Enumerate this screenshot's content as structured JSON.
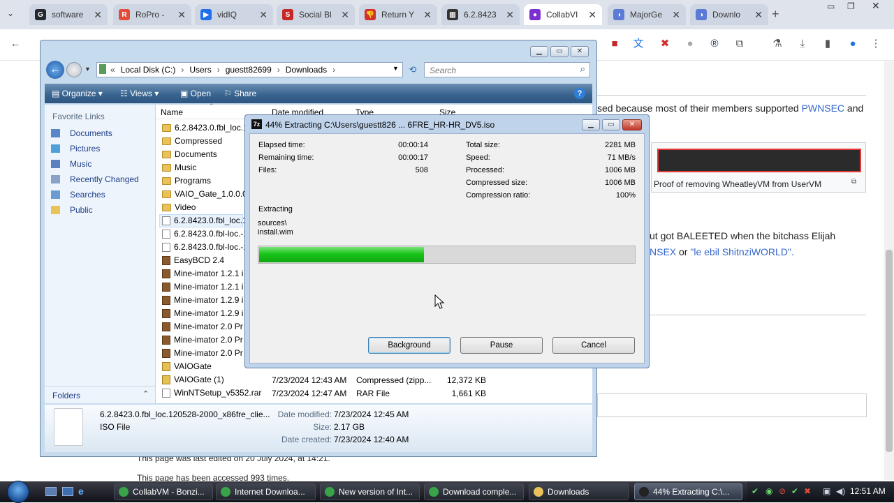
{
  "browser": {
    "tabs": [
      {
        "label": "software",
        "color": "#24292e",
        "glyph": "G"
      },
      {
        "label": "RoPro - ",
        "color": "#e34b3b",
        "glyph": "R"
      },
      {
        "label": "vidIQ",
        "color": "#1f6feb",
        "glyph": "▶"
      },
      {
        "label": "Social Bl",
        "color": "#c62828",
        "glyph": "S"
      },
      {
        "label": "Return Y",
        "color": "#d32f2f",
        "glyph": "👎"
      },
      {
        "label": "6.2.8423",
        "color": "#333333",
        "glyph": "▥"
      },
      {
        "label": "CollabVI",
        "color": "#7b2fd1",
        "glyph": "●",
        "active": true
      },
      {
        "label": "MajorGe",
        "color": "#5c7bd6",
        "glyph": "◑"
      },
      {
        "label": "Downlo",
        "color": "#5c7bd6",
        "glyph": "◑"
      }
    ]
  },
  "webpage": {
    "line1_a": "sed because most of their members supported ",
    "line1_link": "PWNSEC",
    "line1_b": " and",
    "caption": "Proof of removing WheatleyVM from UserVM",
    "line2": "ut got BALEETED when the bitchass Elijah",
    "line3_a": "NSEX",
    "line3_b": " or ",
    "line3_c": "\"le ebil ShitnziWORLD\".",
    "footer1": "This page was last edited on 20 July 2024, at 14:21.",
    "footer2": "This page has been accessed 993 times."
  },
  "explorer": {
    "breadcrumb": [
      "«",
      "Local Disk (C:)",
      "›",
      "Users",
      "›",
      "guestt82699",
      "›",
      "Downloads",
      "›"
    ],
    "search_placeholder": "Search",
    "commands": {
      "organize": "Organize",
      "views": "Views",
      "open": "Open",
      "share": "Share"
    },
    "favorite_links_title": "Favorite Links",
    "nav": [
      "Documents",
      "Pictures",
      "Music",
      "Recently Changed",
      "Searches",
      "Public"
    ],
    "folders_label": "Folders",
    "columns": {
      "name": "Name",
      "date": "Date modified",
      "type": "Type",
      "size": "Size"
    },
    "files": [
      {
        "name": "6.2.8423.0.fbl_loc.12",
        "icon": "folder",
        "date": "",
        "type": "",
        "size": ""
      },
      {
        "name": "Compressed",
        "icon": "folder",
        "date": "",
        "type": "",
        "size": ""
      },
      {
        "name": "Documents",
        "icon": "folder",
        "date": "",
        "type": "",
        "size": ""
      },
      {
        "name": "Music",
        "icon": "folder",
        "date": "",
        "type": "",
        "size": ""
      },
      {
        "name": "Programs",
        "icon": "folder",
        "date": "",
        "type": "",
        "size": ""
      },
      {
        "name": "VAIO_Gate_1.0.0.08",
        "icon": "folder",
        "date": "",
        "type": "",
        "size": ""
      },
      {
        "name": "Video",
        "icon": "folder",
        "date": "",
        "type": "",
        "size": ""
      },
      {
        "name": "6.2.8423.0.fbl_loc.12",
        "icon": "doc",
        "date": "",
        "type": "",
        "size": ""
      },
      {
        "name": "6.2.8423.0.fbl-loc.-1",
        "icon": "doc",
        "date": "",
        "type": "",
        "size": ""
      },
      {
        "name": "6.2.8423.0.fbl-loc.-1",
        "icon": "doc",
        "date": "",
        "type": "",
        "size": ""
      },
      {
        "name": "EasyBCD 2.4",
        "icon": "pkg",
        "date": "",
        "type": "",
        "size": ""
      },
      {
        "name": "Mine-imator 1.2.1 i",
        "icon": "pkg",
        "date": "",
        "type": "",
        "size": ""
      },
      {
        "name": "Mine-imator 1.2.1 i",
        "icon": "pkg",
        "date": "",
        "type": "",
        "size": ""
      },
      {
        "name": "Mine-imator 1.2.9 i",
        "icon": "pkg",
        "date": "",
        "type": "",
        "size": ""
      },
      {
        "name": "Mine-imator 1.2.9 i",
        "icon": "pkg",
        "date": "",
        "type": "",
        "size": ""
      },
      {
        "name": "Mine-imator 2.0 Pr",
        "icon": "pkg",
        "date": "",
        "type": "",
        "size": ""
      },
      {
        "name": "Mine-imator 2.0 Pr",
        "icon": "pkg",
        "date": "",
        "type": "",
        "size": ""
      },
      {
        "name": "Mine-imator 2.0 Pr",
        "icon": "pkg",
        "date": "",
        "type": "",
        "size": ""
      },
      {
        "name": "VAIOGate",
        "icon": "zip",
        "date": "",
        "type": "",
        "size": ""
      },
      {
        "name": "VAIOGate (1)",
        "icon": "zip",
        "date": "7/23/2024 12:43 AM",
        "type": "Compressed (zipp...",
        "size": "12,372 KB"
      },
      {
        "name": "WinNTSetup_v5352.rar",
        "icon": "rar",
        "date": "7/23/2024 12:47 AM",
        "type": "RAR File",
        "size": "1,661 KB"
      }
    ],
    "details": {
      "filename": "6.2.8423.0.fbl_loc.120528-2000_x86fre_clie...",
      "filetype": "ISO File",
      "date_modified_label": "Date modified:",
      "date_modified": "7/23/2024 12:45 AM",
      "size_label": "Size:",
      "size": "2.17 GB",
      "date_created_label": "Date created:",
      "date_created": "7/23/2024 12:40 AM"
    }
  },
  "sevenzip": {
    "title": "44% Extracting C:\\Users\\guestt826 ... 6FRE_HR-HR_DV5.iso",
    "progress": 0.44,
    "stats_left": [
      {
        "label": "Elapsed time:",
        "value": "00:00:14"
      },
      {
        "label": "Remaining time:",
        "value": "00:00:17"
      },
      {
        "label": "Files:",
        "value": "508"
      }
    ],
    "stats_right": [
      {
        "label": "Total size:",
        "value": "2281 MB"
      },
      {
        "label": "Speed:",
        "value": "71 MB/s"
      },
      {
        "label": "Processed:",
        "value": "1006 MB"
      },
      {
        "label": "Compressed size:",
        "value": "1006 MB"
      },
      {
        "label": "Compression ratio:",
        "value": "100%"
      }
    ],
    "action": "Extracting",
    "path_line1": "sources\\",
    "path_line2": "install.wim",
    "buttons": {
      "background": "Background",
      "pause": "Pause",
      "cancel": "Cancel"
    }
  },
  "taskbar": {
    "items": [
      {
        "label": "CollabVM - Bonzi...",
        "color": "#3aa34a"
      },
      {
        "label": "Internet Downloa...",
        "color": "#3aa34a"
      },
      {
        "label": "New version of Int...",
        "color": "#3aa34a"
      },
      {
        "label": "Download comple...",
        "color": "#3aa34a"
      },
      {
        "label": "Downloads",
        "color": "#e9c25a"
      },
      {
        "label": "44% Extracting C:\\...",
        "color": "#222222",
        "active": true
      }
    ],
    "clock": "12:51 AM"
  }
}
